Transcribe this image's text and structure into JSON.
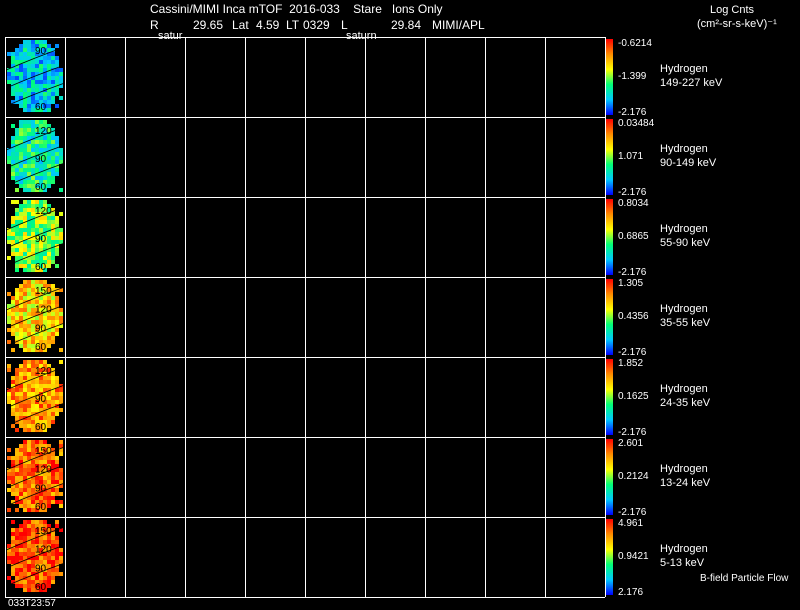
{
  "header": {
    "title": "Cassini/MIMI Inca mTOF  2016-033    Stare   Ions Only",
    "r_label": "R",
    "r_value": "29.65",
    "lat_label": "Lat",
    "lat_value": "4.59",
    "lt_label": "LT",
    "lt_value": "0329",
    "l_label": "L",
    "l_value": "29.84",
    "org": "MIMI/APL",
    "satur_left": "satur",
    "saturn_mid": "saturn"
  },
  "units": {
    "line1": "Log Cnts",
    "line2": "(cm²-sr-s-keV)⁻¹"
  },
  "footer": {
    "timestamp": "033T23:57",
    "legend_note": "B-field Particle Flow"
  },
  "colors": {
    "background": "#000000",
    "grid": "#ffffff",
    "colorbar": [
      "#ff0000",
      "#ff8c00",
      "#ffff00",
      "#00ff66",
      "#00c8ff",
      "#0000ff"
    ]
  },
  "chart_data": {
    "type": "heatmap",
    "panel_columns": 10,
    "image_column_count": 1,
    "contour_labels_default": [
      "120",
      "90",
      "60"
    ],
    "rows": [
      {
        "species": "Hydrogen",
        "energy": "149-227 keV",
        "cb_max": "-0.6214",
        "cb_mid": "-1.399",
        "cb_min": "-2.176",
        "contour_labels": [
          "90",
          "60"
        ],
        "mean_fill": 0.25
      },
      {
        "species": "Hydrogen",
        "energy": "90-149 keV",
        "cb_max": "0.03484",
        "cb_mid": "1.071",
        "cb_min": "-2.176",
        "contour_labels": [
          "120",
          "90",
          "60"
        ],
        "mean_fill": 0.35
      },
      {
        "species": "Hydrogen",
        "energy": "55-90 keV",
        "cb_max": "0.8034",
        "cb_mid": "0.6865",
        "cb_min": "-2.176",
        "contour_labels": [
          "120",
          "90",
          "60"
        ],
        "mean_fill": 0.5
      },
      {
        "species": "Hydrogen",
        "energy": "35-55 keV",
        "cb_max": "1.305",
        "cb_mid": "0.4356",
        "cb_min": "-2.176",
        "contour_labels": [
          "150",
          "120",
          "90",
          "60"
        ],
        "mean_fill": 0.68
      },
      {
        "species": "Hydrogen",
        "energy": "24-35 keV",
        "cb_max": "1.852",
        "cb_mid": "0.1625",
        "cb_min": "-2.176",
        "contour_labels": [
          "120",
          "90",
          "60"
        ],
        "mean_fill": 0.78
      },
      {
        "species": "Hydrogen",
        "energy": "13-24 keV",
        "cb_max": "2.601",
        "cb_mid": "0.2124",
        "cb_min": "-2.176",
        "contour_labels": [
          "150",
          "120",
          "90",
          "60"
        ],
        "mean_fill": 0.85
      },
      {
        "species": "Hydrogen",
        "energy": "5-13 keV",
        "cb_max": "4.961",
        "cb_mid": "0.9421",
        "cb_min": "2.176",
        "contour_labels": [
          "150",
          "120",
          "90",
          "60"
        ],
        "mean_fill": 0.9
      }
    ]
  }
}
